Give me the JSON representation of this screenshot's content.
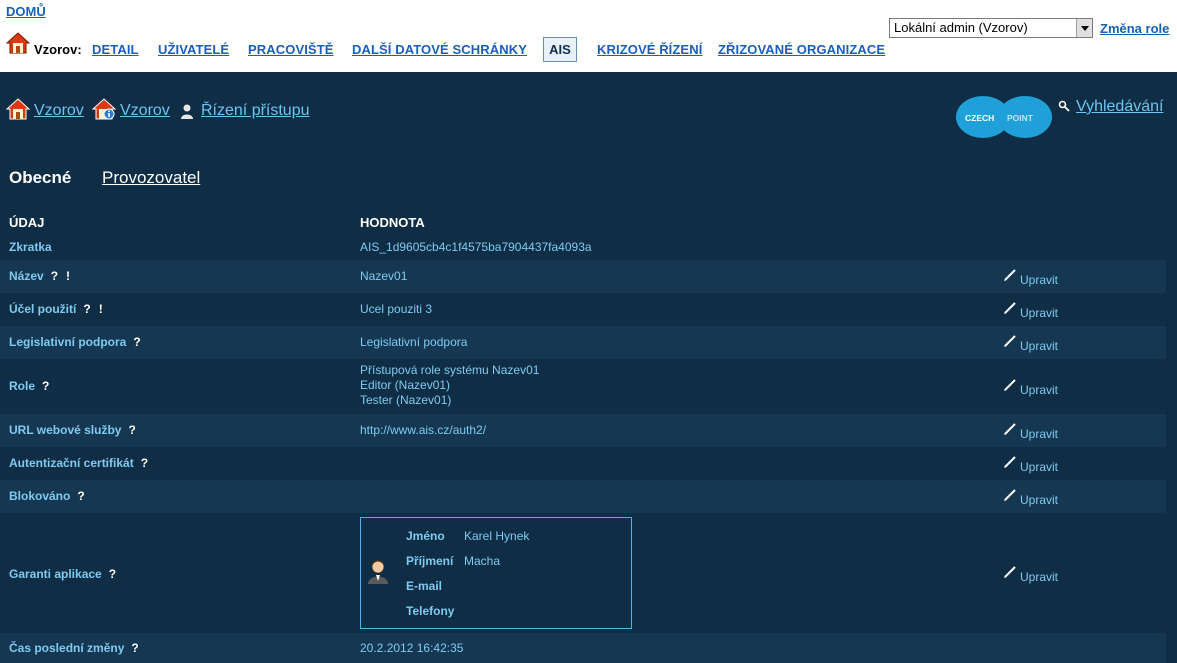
{
  "top": {
    "home_link": "DOMŮ",
    "org_label": "Vzorov:",
    "nav": [
      "DETAIL",
      "UŽIVATELÉ",
      "PRACOVIŠTĚ",
      "DALŠÍ DATOVÉ SCHRÁNKY",
      "AIS",
      "KRIZOVÉ ŘÍZENÍ",
      "ZŘIZOVANÉ ORGANIZACE"
    ],
    "active_tab": "AIS",
    "role_select_value": "Lokální admin (Vzorov)",
    "change_role": "Změna role"
  },
  "breadcrumb": {
    "items": [
      "Vzorov",
      "Vzorov",
      "Řízení přístupu"
    ]
  },
  "logo": {
    "part1": "CZECH",
    "part2": "POINT"
  },
  "search_link": "Vyhledávání",
  "section_tabs": {
    "general": "Obecné",
    "operator": "Provozovatel"
  },
  "table": {
    "col_field": "ÚDAJ",
    "col_value": "HODNOTA",
    "edit_label": "Upravit",
    "help": "?",
    "required": "!",
    "rows": [
      {
        "field": "Zkratka",
        "value": "AIS_1d9605cb4c1f4575ba7904437fa4093a"
      },
      {
        "field": "Název",
        "value": "Nazev01"
      },
      {
        "field": "Účel použití",
        "value": "Ucel pouziti 3"
      },
      {
        "field": "Legislativní podpora",
        "value": "Legislativní podpora"
      },
      {
        "field": "Role",
        "values": [
          "Přístupová role systému Nazev01",
          "Editor (Nazev01)",
          "Tester (Nazev01)"
        ]
      },
      {
        "field": "URL webové služby",
        "value": "http://www.ais.cz/auth2/"
      },
      {
        "field": "Autentizační certifikát",
        "value": ""
      },
      {
        "field": "Blokováno",
        "value": ""
      },
      {
        "field": "Garanti aplikace",
        "value": ""
      },
      {
        "field": "Čas poslední změny",
        "value": "20.2.2012 16:42:35"
      }
    ],
    "guarantor": {
      "labels": [
        "Jméno",
        "Příjmení",
        "E-mail",
        "Telefony"
      ],
      "first_name": "Karel Hynek",
      "last_name": "Macha",
      "email": "",
      "phones": ""
    }
  },
  "colors": {
    "background": "#0f2d45",
    "row_alt": "#153752",
    "link": "#6cc4ef",
    "text": "#7fcaee",
    "logo": "#1fa0d8"
  }
}
